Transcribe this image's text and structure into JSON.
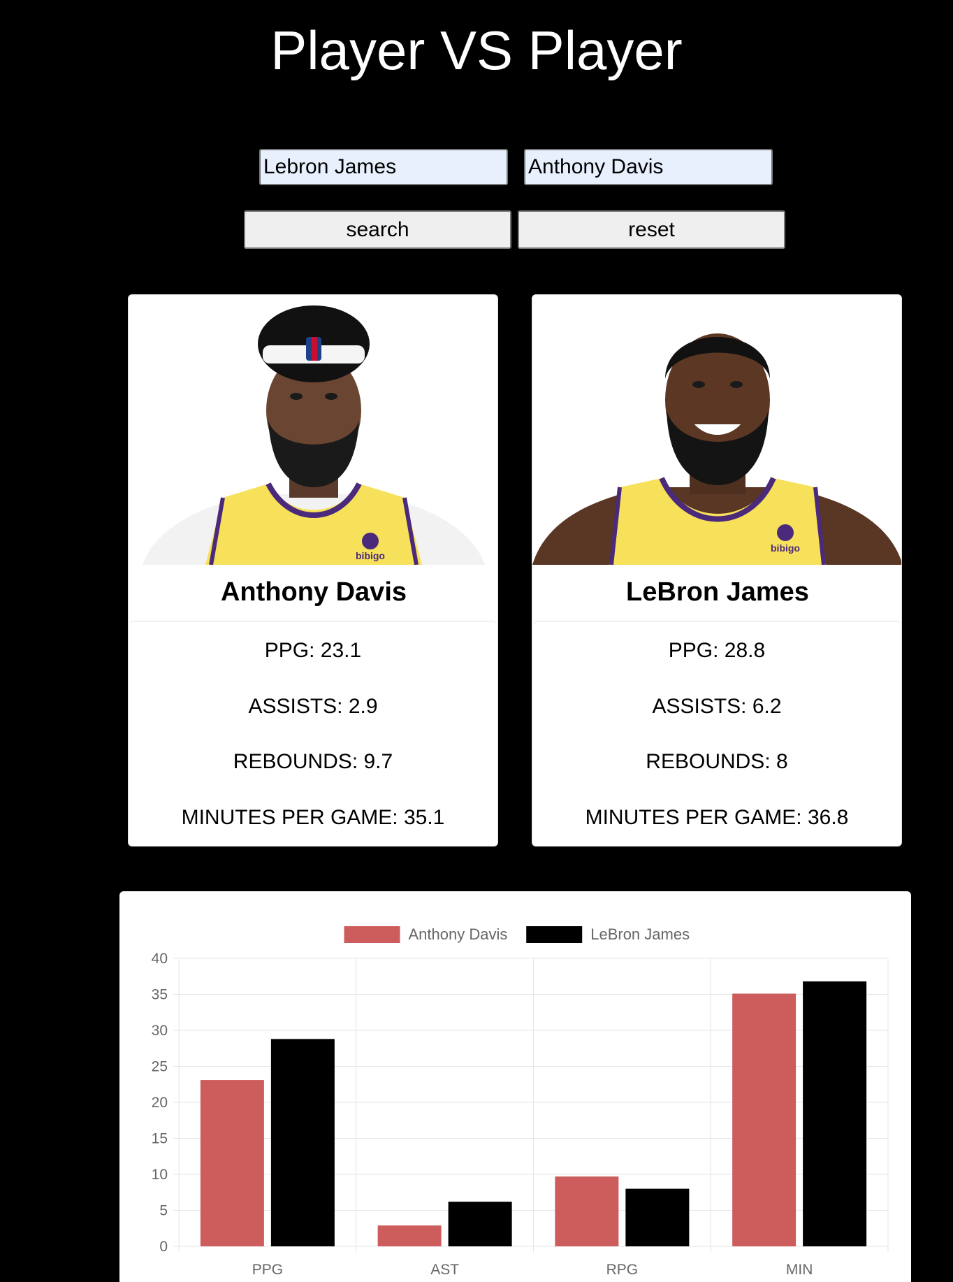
{
  "header": {
    "title": "Player VS Player"
  },
  "form": {
    "player1_value": "Lebron James",
    "player2_value": "Anthony Davis",
    "search_label": "search",
    "reset_label": "reset"
  },
  "cards": [
    {
      "name": "Anthony Davis",
      "stats": {
        "ppg": "PPG: 23.1",
        "assists": "ASSISTS: 2.9",
        "rebounds": "REBOUNDS: 9.7",
        "minutes": "MINUTES PER GAME: 35.1"
      }
    },
    {
      "name": "LeBron James",
      "stats": {
        "ppg": "PPG: 28.8",
        "assists": "ASSISTS: 6.2",
        "rebounds": "REBOUNDS: 8",
        "minutes": "MINUTES PER GAME: 36.8"
      }
    }
  ],
  "colors": {
    "background": "#000000",
    "series1": "#cd5c5c",
    "series2": "#000000",
    "input_bg": "#e8f0fe"
  },
  "chart_data": {
    "type": "bar",
    "categories": [
      "PPG",
      "AST",
      "RPG",
      "MIN"
    ],
    "series": [
      {
        "name": "Anthony Davis",
        "values": [
          23.1,
          2.9,
          9.7,
          35.1
        ],
        "color": "#cd5c5c"
      },
      {
        "name": "LeBron James",
        "values": [
          28.8,
          6.2,
          8,
          36.8
        ],
        "color": "#000000"
      }
    ],
    "yticks": [
      "0",
      "5",
      "10",
      "15",
      "20",
      "25",
      "30",
      "35",
      "40"
    ],
    "ylim": [
      0,
      40
    ],
    "grid": true,
    "legend": "top-center"
  }
}
